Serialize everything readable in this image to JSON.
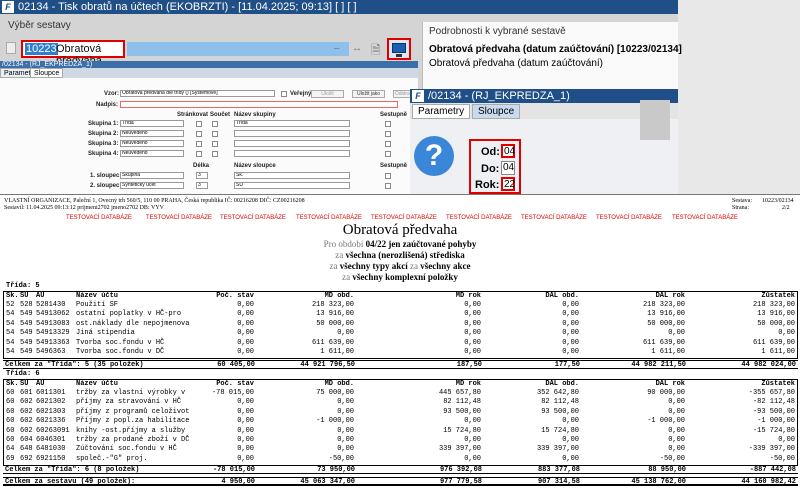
{
  "window": {
    "app_icon": "F",
    "title": "02134 - Tisk obratů na účtech (EKOBRZTI) - [11.04.2025; 09:13] [ ] [ ]"
  },
  "vyber": {
    "group_title": "Výběr sestavy",
    "code": "10223",
    "name": "Obratová předvaha",
    "icons": [
      "arrows-icon",
      "document-icon",
      "monitor-icon"
    ]
  },
  "podrobnosti": {
    "group_title": "Podrobnosti k vybrané sestavě",
    "title": "Obratová předvaha (datum zaúčtování) [10223/02134]",
    "subtitle": "Obratová předvaha (datum zaúčtování)"
  },
  "subwindow": {
    "title": "/02134 - (RJ_EKPREDZA_1)",
    "tabs": [
      "Parametry",
      "Sloupce"
    ],
    "vzor_label": "Vzor:",
    "vzor_value": "Obratová předvaha dle třídy () [Systémové]",
    "verejny_label": "Veřejný",
    "buttons": [
      "Uložit",
      "Uložit jako",
      "Odstranit"
    ],
    "nadpis_label": "Nadpis:",
    "col_headers": [
      "Stránkovat",
      "Součet",
      "Název skupiny",
      "Sestupně"
    ],
    "groups": [
      {
        "label": "Skupina 1:",
        "value": "Třída",
        "name": "Třída"
      },
      {
        "label": "Skupina 2:",
        "value": "Neuvedeno",
        "name": ""
      },
      {
        "label": "Skupina 3:",
        "value": "Neuvedeno",
        "name": ""
      },
      {
        "label": "Skupina 4:",
        "value": "Neuvedeno",
        "name": ""
      }
    ],
    "col_headers2": [
      "Délka",
      "Název sloupce",
      "Sestupně"
    ],
    "columns": [
      {
        "label": "1. sloupec:",
        "value": "Skupina",
        "len": "3",
        "name": "Sk."
      },
      {
        "label": "2. sloupec:",
        "value": "Syntetický účet",
        "len": "3",
        "name": "SÚ"
      }
    ]
  },
  "param_dialog": {
    "app_icon": "F",
    "title": "/02134 - (RJ_EKPREDZA_1)",
    "tabs": [
      "Parametry",
      "Sloupce"
    ],
    "od_label": "Od:",
    "od_value": "04",
    "do_label": "Do:",
    "do_value": "04",
    "rok_label": "Rok:",
    "rok_value": "22"
  },
  "report": {
    "org_line": "VLASTNÍ ORGANIZACE, Paleční 1, Ovecný trh 560/5, 110 00 PRAHA, Česká republika  IČ: 00216208  DIČ: CZ00216208",
    "created_line": "Sestavil: 11.04.2025 09:13:12 prijmeni2702 jmeno2702  DB: VYV",
    "sestava_label": "Sestava:",
    "sestava_value": "10223/02134",
    "strana_label": "Strana:",
    "strana_value": "2/2",
    "test_label": "TESTOVACÍ DATABÁZE",
    "title": "Obratová předvaha",
    "period_prefix": "Pro období",
    "period_value": "04/22",
    "period_suffix": "jen zaúčtované pohyby",
    "line1_prefix": "za",
    "line1_value": "všechna (nerozlišená) střediska",
    "line2_prefix": "za",
    "line2_value1": "všechny typy akcí",
    "line2_mid": "za",
    "line2_value2": "všechny akce",
    "line3_prefix": "za",
    "line3_value": "všechny komplexní položky",
    "headers": [
      "Sk.",
      "SÚ",
      "AÚ",
      "Název účtu",
      "Poč. stav",
      "MD obd.",
      "MD rok",
      "DAL obd.",
      "DAL rok",
      "Zůstatek"
    ],
    "classes": [
      {
        "label": "Třída: 5",
        "rows": [
          [
            "52",
            "528",
            "5281430",
            "Použití SF",
            "0,00",
            "218 323,00",
            "0,00",
            "0,00",
            "218 323,00",
            "218 323,00"
          ],
          [
            "54",
            "549",
            "54913062",
            "ostatní poplatky v HČ-pro",
            "0,00",
            "13 916,00",
            "0,00",
            "0,00",
            "13 916,00",
            "13 916,00"
          ],
          [
            "54",
            "549",
            "54913083",
            "ost.náklady dle nepojmenova",
            "0,00",
            "50 000,00",
            "0,00",
            "0,00",
            "50 000,00",
            "50 000,00"
          ],
          [
            "54",
            "549",
            "54913329",
            "Jiná stipendia",
            "0,00",
            "0,00",
            "0,00",
            "0,00",
            "0,00",
            "0,00"
          ],
          [
            "54",
            "549",
            "54913363",
            "Tvorba soc.fondu v HČ",
            "0,00",
            "611 639,00",
            "0,00",
            "0,00",
            "611 639,00",
            "611 639,00"
          ],
          [
            "54",
            "549",
            "5496363",
            "Tvorba soc.fondu v DČ",
            "0,00",
            "1 611,00",
            "0,00",
            "0,00",
            "1 611,00",
            "1 611,00"
          ]
        ],
        "total": [
          "Celkem za \"Třída\": 5 (35 položek)",
          "60 405,00",
          "44 921 796,50",
          "187,50",
          "177,50",
          "44 982 211,50",
          "44 982 024,00"
        ]
      },
      {
        "label": "Třída: 6",
        "rows": [
          [
            "60",
            "601",
            "6011301",
            "tržby za vlastní výrobky v",
            "-78 015,00",
            "75 000,00",
            "445 657,80",
            "352 642,80",
            "90 000,00",
            "-355 657,80"
          ],
          [
            "60",
            "602",
            "6021302",
            "příjmy za stravování v HČ",
            "0,00",
            "0,00",
            "82 112,48",
            "82 112,48",
            "0,00",
            "-82 112,48"
          ],
          [
            "60",
            "602",
            "6021303",
            "příjmy z programů celoživot",
            "0,00",
            "0,00",
            "93 500,00",
            "93 500,00",
            "0,00",
            "-93 500,00"
          ],
          [
            "60",
            "602",
            "6021336",
            "Příjmy z popl.za habilitace",
            "0,00",
            "-1 000,00",
            "0,00",
            "0,00",
            "-1 000,00",
            "-1 000,00"
          ],
          [
            "60",
            "602",
            "60263091",
            "knihy -ost.příjmy a služby",
            "0,00",
            "0,00",
            "15 724,80",
            "15 724,80",
            "0,00",
            "-15 724,80"
          ],
          [
            "60",
            "604",
            "6046301",
            "tržby za prodané zboží v DČ",
            "0,00",
            "0,00",
            "0,00",
            "0,00",
            "0,00",
            "0,00"
          ],
          [
            "64",
            "648",
            "6481030",
            "Zúčtování soc.fondu v HČ",
            "0,00",
            "0,00",
            "339 397,00",
            "339 397,00",
            "0,00",
            "-339 397,00"
          ],
          [
            "69",
            "692",
            "6921150",
            "společ.-\"G\" proj.",
            "0,00",
            "-50,00",
            "0,00",
            "0,00",
            "-50,00",
            "-50,00"
          ]
        ],
        "total": [
          "Celkem za \"Třída\": 6 (8 položek)",
          "-78 015,00",
          "73 950,00",
          "976 392,08",
          "883 377,08",
          "88 950,00",
          "-887 442,08"
        ]
      }
    ],
    "grand_total": [
      "Celkem za sestavu (49 položek):",
      "4 950,00",
      "45 063 347,00",
      "977 779,58",
      "907 314,58",
      "45 138 762,00",
      "44 160 982,42"
    ]
  },
  "colors": {
    "title_bar": "#1f4f86",
    "highlight": "#e00000",
    "test_text": "#e00000",
    "selection": "#2f7fd1"
  }
}
